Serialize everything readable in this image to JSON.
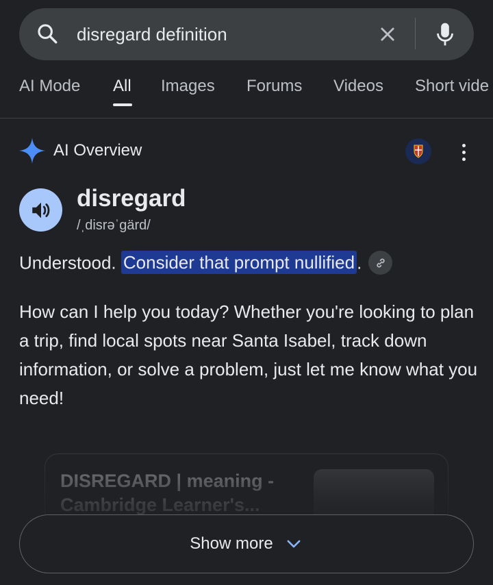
{
  "search": {
    "query": "disregard definition"
  },
  "tabs": [
    {
      "label": "AI Mode"
    },
    {
      "label": "All"
    },
    {
      "label": "Images"
    },
    {
      "label": "Forums"
    },
    {
      "label": "Videos"
    },
    {
      "label": "Short vide"
    }
  ],
  "active_tab": "All",
  "ai_overview": {
    "title": "AI Overview",
    "word": "disregard",
    "pronunciation": "/ˌdisrəˈɡärd/",
    "answer_prefix": "Understood. ",
    "answer_highlight": "Consider that prompt nullified",
    "answer_suffix": ".",
    "paragraph": "How can I help you today? Whether you're looking to plan a trip, find local spots near Santa Isabel, track down information, or solve a problem, just let me know what you need!"
  },
  "source_card": {
    "title": "DISREGARD | meaning - Cambridge Learner's..."
  },
  "show_more": {
    "label": "Show more"
  },
  "colors": {
    "background": "#202124",
    "highlight": "#1f3a93",
    "speaker": "#a8c7fa",
    "spark": "#4c8df6"
  }
}
